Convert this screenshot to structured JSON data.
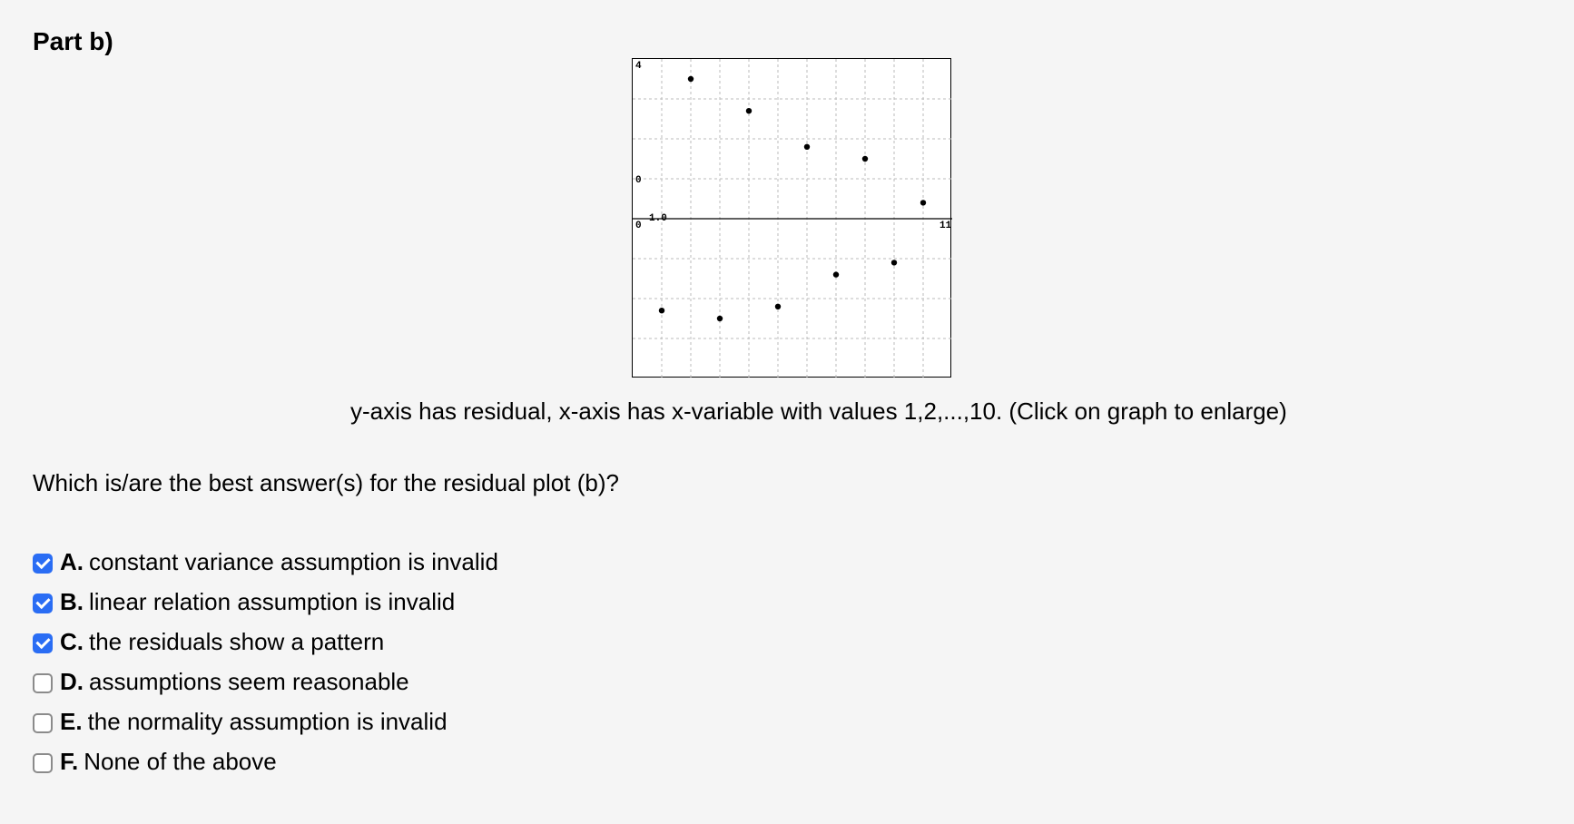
{
  "part_label": "Part b)",
  "chart_caption": "y-axis has residual, x-axis has x-variable with values 1,2,...,10. (Click on graph to enlarge)",
  "question_text": "Which is/are the best answer(s) for the residual plot (b)?",
  "options": [
    {
      "letter": "A.",
      "text": "constant variance assumption is invalid",
      "checked": true
    },
    {
      "letter": "B.",
      "text": "linear relation assumption is invalid",
      "checked": true
    },
    {
      "letter": "C.",
      "text": "the residuals show a pattern",
      "checked": true
    },
    {
      "letter": "D.",
      "text": "assumptions seem reasonable",
      "checked": false
    },
    {
      "letter": "E.",
      "text": "the normality assumption is invalid",
      "checked": false
    },
    {
      "letter": "F.",
      "text": "None of the above",
      "checked": false
    }
  ],
  "axis_labels": {
    "y_top": "4",
    "y_zero": "0",
    "x_origin_left": "0",
    "x_origin_right": "1.0",
    "x_max": "11"
  },
  "chart_data": {
    "type": "scatter",
    "title": "",
    "xlabel": "x-variable",
    "ylabel": "residual",
    "xlim": [
      0,
      11
    ],
    "ylim": [
      -4,
      4
    ],
    "x": [
      1,
      2,
      3,
      4,
      5,
      6,
      7,
      8,
      9,
      10
    ],
    "y": [
      -2.3,
      3.5,
      -2.5,
      2.7,
      -2.2,
      1.8,
      -1.4,
      1.5,
      -1.1,
      0.4
    ]
  }
}
